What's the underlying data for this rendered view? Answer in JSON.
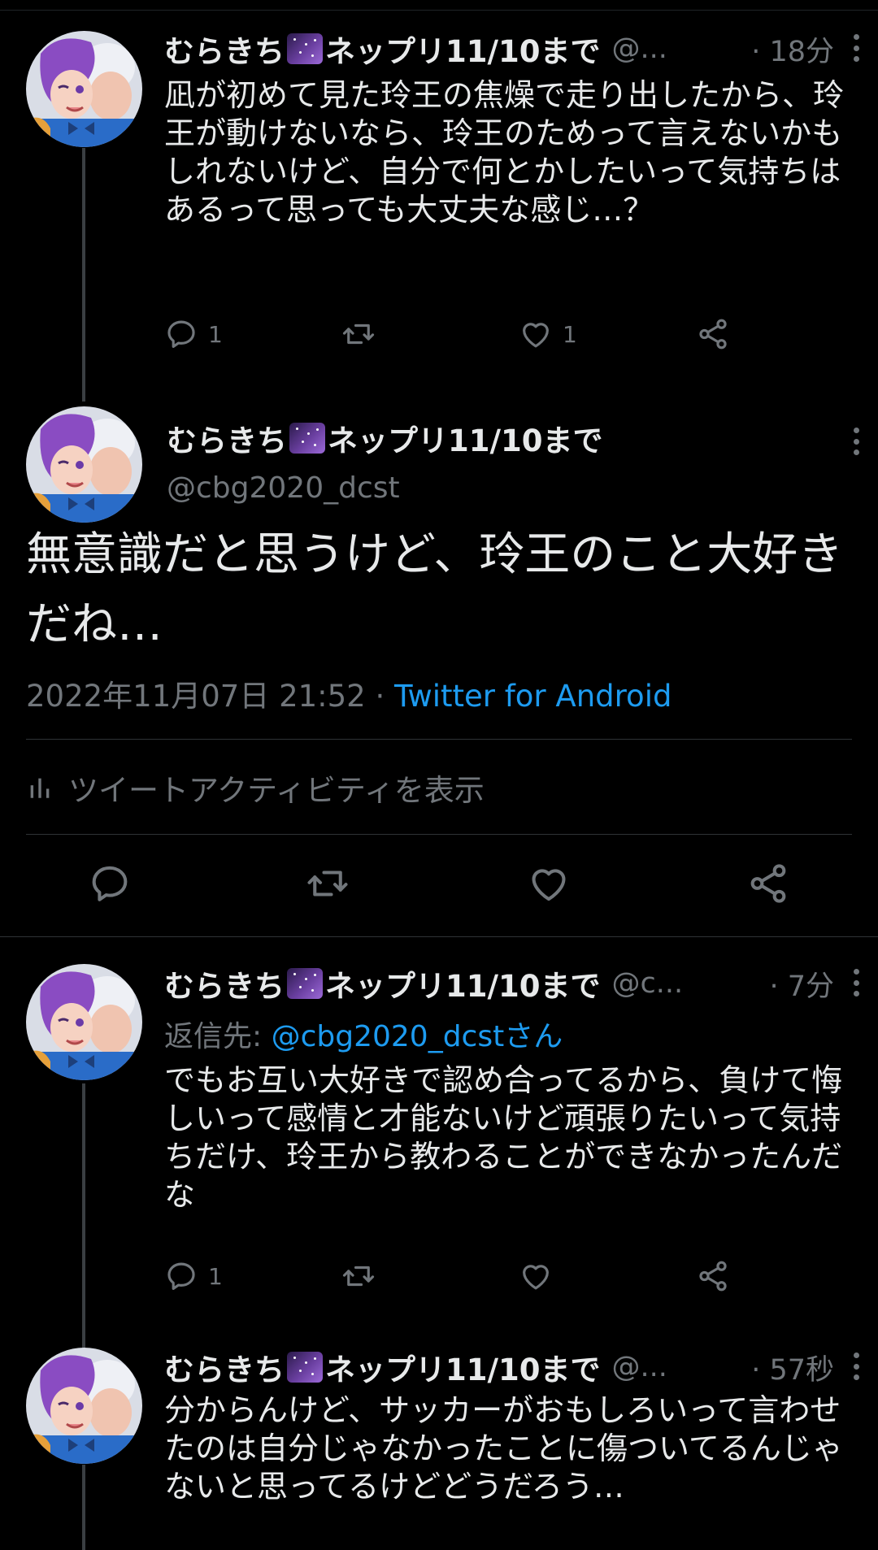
{
  "tweets": [
    {
      "name_before": "むらきち",
      "name_after": "ネップリ11/10まで",
      "handle": "@...",
      "time": "· 18分",
      "text": "凪が初めて見た玲王の焦燥で走り出したから、玲王が動けないなら、玲王のためって言えないかもしれないけど、自分で何とかしたいって気持ちはあるって思っても大丈夫な感じ…？",
      "reply_count": "1",
      "like_count": "1"
    },
    {
      "name_before": "むらきち",
      "name_after": "ネップリ11/10まで",
      "handle": "@c...",
      "time": "· 7分",
      "reply_prefix": "返信先: ",
      "reply_to": "@cbg2020_dcstさん",
      "text": "でもお互い大好きで認め合ってるから、負けて悔しいって感情と才能ないけど頑張りたいって気持ちだけ、玲王から教わることができなかったんだな",
      "reply_count": "1",
      "like_count": ""
    },
    {
      "name_before": "むらきち",
      "name_after": "ネップリ11/10まで",
      "handle": "@...",
      "time": "· 57秒",
      "text": "分からんけど、サッカーがおもしろいって言わせたのは自分じゃなかったことに傷ついてるんじゃないと思ってるけどどうだろう…"
    }
  ],
  "main": {
    "name_before": "むらきち",
    "name_after": "ネップリ11/10まで",
    "handle": "@cbg2020_dcst",
    "text": "無意識だと思うけど、玲王のこと大好きだね…",
    "date": "2022年11月07日 21:52 · ",
    "source": "Twitter for Android",
    "activity_label": "ツイートアクティビティを表示"
  },
  "icons": [
    "reply-icon",
    "retweet-icon",
    "like-icon",
    "share-icon",
    "more-icon",
    "activity-icon",
    "night-sky-emoji"
  ],
  "colors": {
    "background": "#000000",
    "text": "#e7e9ea",
    "muted": "#71767b",
    "link": "#1d9bf0"
  }
}
